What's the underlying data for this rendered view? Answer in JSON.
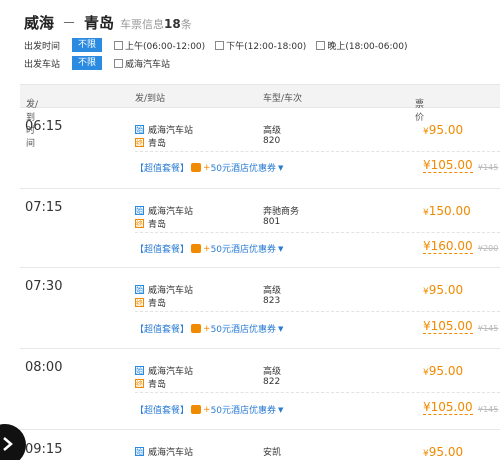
{
  "header": {
    "from": "威海",
    "dash": "－",
    "to": "青岛",
    "count_prefix": "车票信息",
    "count": "18",
    "count_suffix": "条"
  },
  "filters": {
    "depart_time_label": "出发时间",
    "depart_station_label": "出发车站",
    "unlimited": "不限",
    "time_options": [
      "上午(06:00-12:00)",
      "下午(12:00-18:00)",
      "晚上(18:00-06:00)"
    ],
    "station_options": [
      "威海汽车站"
    ]
  },
  "table": {
    "headers": {
      "time": "发/到时间",
      "station": "发/到站",
      "bus": "车型/车次",
      "price": "票价"
    },
    "sort_glyph": "⇕",
    "start_tag": "始",
    "end_tag": "终",
    "promo": {
      "label": "【超值套餐】",
      "plus": "+",
      "text": "50元酒店优惠券"
    },
    "currency": "¥",
    "rows": [
      {
        "time": "06:15",
        "from": "威海汽车站",
        "to": "青岛",
        "bus_type": "高级",
        "bus_no": "820",
        "price": "95.00",
        "package_price": "105.00",
        "orig": "¥145"
      },
      {
        "time": "07:15",
        "from": "威海汽车站",
        "to": "青岛",
        "bus_type": "奔驰商务",
        "bus_no": "801",
        "price": "150.00",
        "package_price": "160.00",
        "orig": "¥200"
      },
      {
        "time": "07:30",
        "from": "威海汽车站",
        "to": "青岛",
        "bus_type": "高级",
        "bus_no": "823",
        "price": "95.00",
        "package_price": "105.00",
        "orig": "¥145"
      },
      {
        "time": "08:00",
        "from": "威海汽车站",
        "to": "青岛",
        "bus_type": "高级",
        "bus_no": "822",
        "price": "95.00",
        "package_price": "105.00",
        "orig": "¥145"
      },
      {
        "time": "09:15",
        "from": "威海汽车站",
        "to": "",
        "bus_type": "安凯",
        "bus_no": "",
        "price": "95.00",
        "package_price": "",
        "orig": ""
      }
    ]
  }
}
